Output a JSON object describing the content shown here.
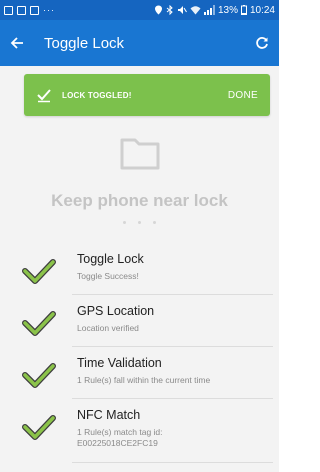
{
  "status_bar": {
    "dots": "···",
    "battery_percent": "13%",
    "time": "10:24"
  },
  "app_bar": {
    "title": "Toggle Lock",
    "back_icon": "arrow-left-icon",
    "refresh_icon": "refresh-icon"
  },
  "snackbar": {
    "message": "LOCK TOGGLED!",
    "action": "DONE",
    "icon": "check-icon",
    "color": "#7cc14c"
  },
  "placeholder": {
    "icon": "folder-icon",
    "text": "Keep phone near lock"
  },
  "steps": [
    {
      "title": "Toggle Lock",
      "subtitle": "Toggle Success!"
    },
    {
      "title": "GPS Location",
      "subtitle": "Location verified"
    },
    {
      "title": "Time Validation",
      "subtitle": "1 Rule(s) fall within the current time"
    },
    {
      "title": "NFC Match",
      "subtitle": "1 Rule(s) match tag id: E00225018CE2FC19"
    }
  ],
  "colors": {
    "app_bar": "#1976d2",
    "status_bar": "#1565c0",
    "check_green": "#7cc14c"
  }
}
